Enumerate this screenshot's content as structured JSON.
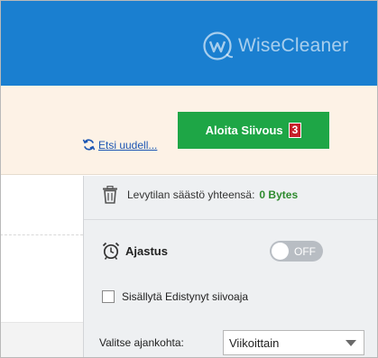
{
  "header": {
    "logo_text": "WiseCleaner",
    "logo_icon": "wisecleaner-w-icon",
    "background": "#1a7fd0"
  },
  "actions": {
    "start_label": "Aloita Siivous",
    "start_badge": "3",
    "start_color": "#1ea646",
    "badge_color": "#c7202a",
    "rescan_label": "Etsi uudell...",
    "rescan_icon": "refresh-icon"
  },
  "savings": {
    "label": "Levytilan säästö yhteensä:",
    "value": "0 Bytes",
    "icon": "trash-icon"
  },
  "schedule": {
    "label": "Ajastus",
    "icon": "alarm-clock-icon",
    "toggle_text": "OFF"
  },
  "advanced": {
    "label": "Sisällytä Edistynyt siivoaja",
    "checked": false
  },
  "period": {
    "label": "Valitse ajankohta:",
    "selected": "Viikoittain"
  }
}
